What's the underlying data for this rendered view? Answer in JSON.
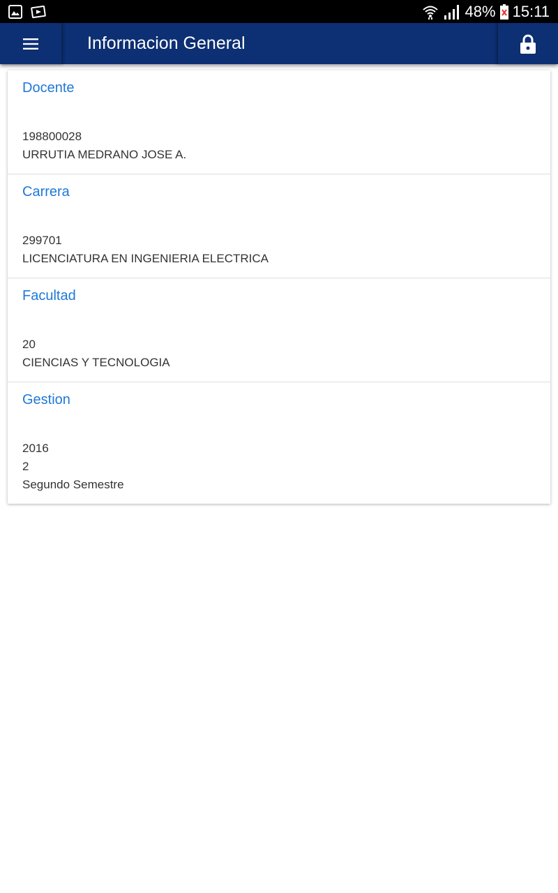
{
  "status_bar": {
    "battery": "48%",
    "time": "15:11"
  },
  "app_bar": {
    "title": "Informacion General"
  },
  "sections": [
    {
      "title": "Docente",
      "lines": [
        "198800028",
        "URRUTIA MEDRANO JOSE A."
      ]
    },
    {
      "title": "Carrera",
      "lines": [
        "299701",
        "LICENCIATURA EN INGENIERIA ELECTRICA"
      ]
    },
    {
      "title": "Facultad",
      "lines": [
        "20",
        "CIENCIAS Y TECNOLOGIA"
      ]
    },
    {
      "title": "Gestion",
      "lines": [
        "2016",
        "2",
        "Segundo Semestre"
      ]
    }
  ],
  "colors": {
    "app_bar": "#0d2f73",
    "section_title": "#1e78d8",
    "text": "#333333"
  }
}
